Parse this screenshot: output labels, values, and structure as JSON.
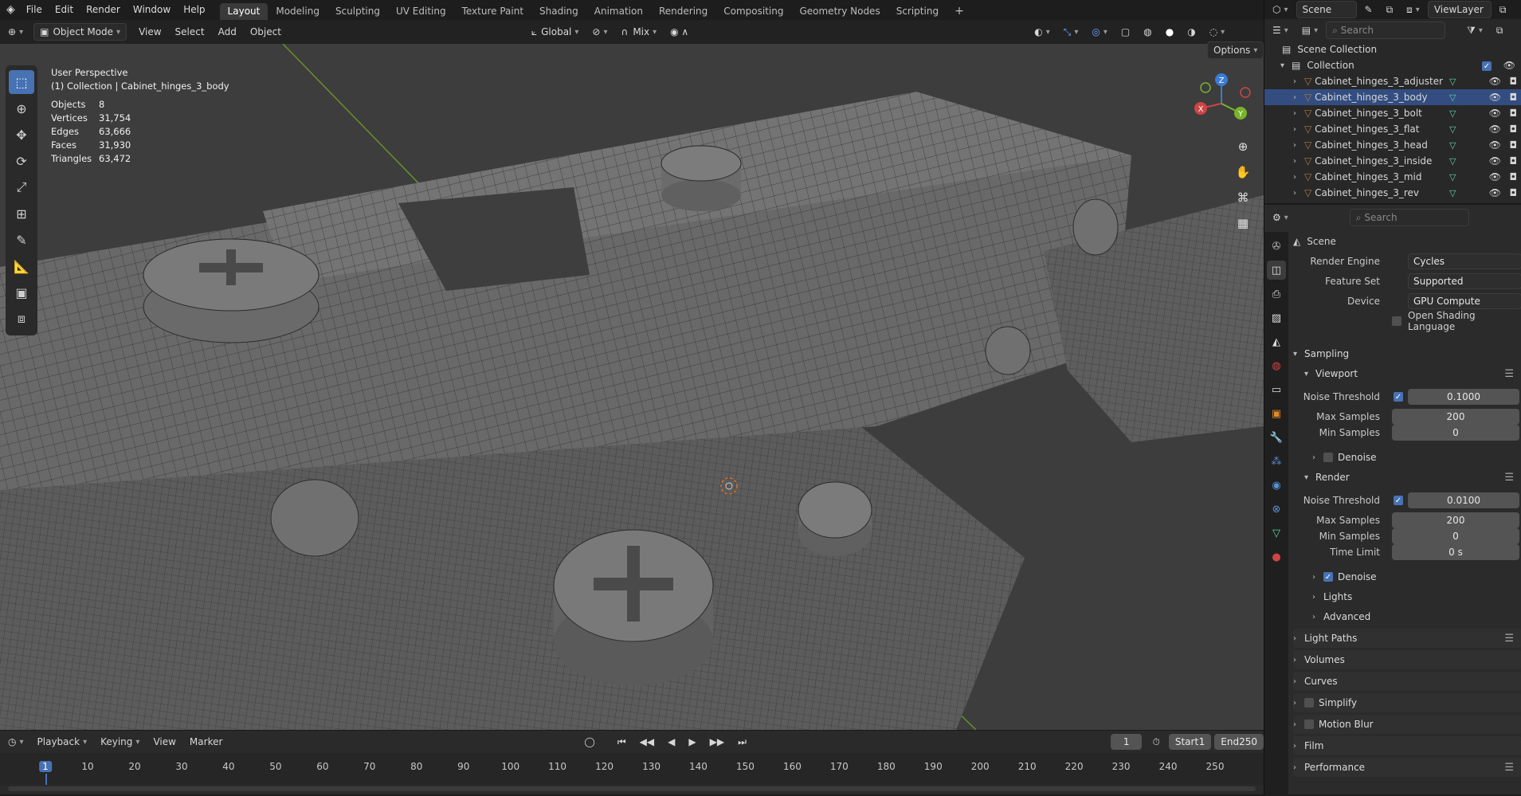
{
  "topbar": {
    "menus": [
      "File",
      "Edit",
      "Render",
      "Window",
      "Help"
    ],
    "workspaces": [
      "Layout",
      "Modeling",
      "Sculpting",
      "UV Editing",
      "Texture Paint",
      "Shading",
      "Animation",
      "Rendering",
      "Compositing",
      "Geometry Nodes",
      "Scripting"
    ],
    "active_workspace": "Layout",
    "add_tab": "+"
  },
  "viewport_header": {
    "mode": "Object Mode",
    "menus": [
      "View",
      "Select",
      "Add",
      "Object"
    ],
    "orientation": "Global",
    "snap": "Mix",
    "options": "Options"
  },
  "viewport": {
    "perspective": "User Perspective",
    "context": "(1) Collection | Cabinet_hinges_3_body",
    "stats": [
      {
        "label": "Objects",
        "value": "8"
      },
      {
        "label": "Vertices",
        "value": "31,754"
      },
      {
        "label": "Edges",
        "value": "63,666"
      },
      {
        "label": "Faces",
        "value": "31,930"
      },
      {
        "label": "Triangles",
        "value": "63,472"
      }
    ],
    "gizmo": {
      "x": "X",
      "y": "Y",
      "z": "Z"
    }
  },
  "timeline": {
    "menus": [
      "Playback",
      "Keying",
      "View",
      "Marker"
    ],
    "current_frame": "1",
    "start_label": "Start",
    "start": "1",
    "end_label": "End",
    "end": "250",
    "ticks": [
      "1",
      "10",
      "20",
      "30",
      "40",
      "50",
      "60",
      "70",
      "80",
      "90",
      "100",
      "110",
      "120",
      "130",
      "140",
      "150",
      "160",
      "170",
      "180",
      "190",
      "200",
      "210",
      "220",
      "230",
      "240",
      "250"
    ]
  },
  "outliner": {
    "scene": "Scene",
    "view_layer": "ViewLayer",
    "search_placeholder": "Search",
    "scene_collection": "Scene Collection",
    "collection": "Collection",
    "objects": [
      "Cabinet_hinges_3_adjuster",
      "Cabinet_hinges_3_body",
      "Cabinet_hinges_3_bolt",
      "Cabinet_hinges_3_flat",
      "Cabinet_hinges_3_head",
      "Cabinet_hinges_3_inside",
      "Cabinet_hinges_3_mid",
      "Cabinet_hinges_3_rev"
    ],
    "selected": "Cabinet_hinges_3_body"
  },
  "properties": {
    "search_placeholder": "Search",
    "context": "Scene",
    "render_engine_label": "Render Engine",
    "render_engine": "Cycles",
    "feature_set_label": "Feature Set",
    "feature_set": "Supported",
    "device_label": "Device",
    "device": "GPU Compute",
    "osl_label": "Open Shading Language",
    "sampling": "Sampling",
    "viewport": "Viewport",
    "noise_threshold_label": "Noise Threshold",
    "vp_noise": "0.1000",
    "max_samples_label": "Max Samples",
    "vp_max": "200",
    "min_samples_label": "Min Samples",
    "vp_min": "0",
    "denoise_label": "Denoise",
    "render": "Render",
    "r_noise": "0.0100",
    "r_max": "200",
    "r_min": "0",
    "time_limit_label": "Time Limit",
    "r_time": "0 s",
    "lights": "Lights",
    "advanced": "Advanced",
    "light_paths": "Light Paths",
    "volumes": "Volumes",
    "curves": "Curves",
    "simplify": "Simplify",
    "motion_blur": "Motion Blur",
    "film": "Film",
    "performance": "Performance"
  }
}
